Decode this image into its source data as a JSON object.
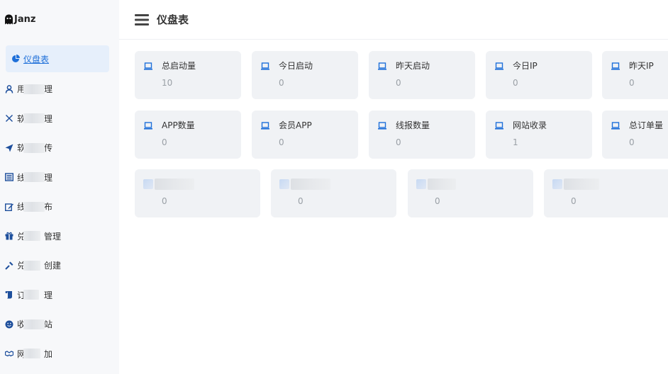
{
  "brand": {
    "text": "Janz"
  },
  "header": {
    "title": "仪盘表"
  },
  "sidebar": {
    "items": [
      {
        "prefix": "仪盘表",
        "suffix": "",
        "icon": "chart-pie-icon",
        "active": true
      },
      {
        "prefix": "用",
        "suffix": "理",
        "icon": "user-icon"
      },
      {
        "prefix": "软",
        "suffix": "理",
        "icon": "tools-icon"
      },
      {
        "prefix": "软",
        "suffix": "传",
        "icon": "send-icon"
      },
      {
        "prefix": "线",
        "suffix": "理",
        "icon": "list-icon"
      },
      {
        "prefix": "线",
        "suffix": "布",
        "icon": "edit-icon"
      },
      {
        "prefix": "兑",
        "suffix": "管理",
        "icon": "gift-icon"
      },
      {
        "prefix": "兑",
        "suffix": "创建",
        "icon": "wrench-icon"
      },
      {
        "prefix": "订",
        "suffix": "理",
        "icon": "scroll-icon"
      },
      {
        "prefix": "收",
        "suffix": "站",
        "icon": "smile-icon"
      },
      {
        "prefix": "网",
        "suffix": "加",
        "icon": "handshake-icon"
      }
    ]
  },
  "stats": {
    "row1": [
      {
        "label": "总启动量",
        "value": "10"
      },
      {
        "label": "今日启动",
        "value": "0"
      },
      {
        "label": "昨天启动",
        "value": "0"
      },
      {
        "label": "今日IP",
        "value": "0"
      },
      {
        "label": "昨天IP",
        "value": "0"
      }
    ],
    "row2": [
      {
        "label": "APP数量",
        "value": "0"
      },
      {
        "label": "会员APP",
        "value": "0"
      },
      {
        "label": "线报数量",
        "value": "0"
      },
      {
        "label": "网站收录",
        "value": "1"
      },
      {
        "label": "总订单量",
        "value": "0"
      }
    ],
    "row3": [
      {
        "value": "0"
      },
      {
        "value": "0"
      },
      {
        "value": "0"
      },
      {
        "value": "0"
      }
    ]
  },
  "colors": {
    "accent": "#1e6fd9",
    "card_bg": "#f0f2f5",
    "sidebar_bg": "#f7f8fa"
  }
}
